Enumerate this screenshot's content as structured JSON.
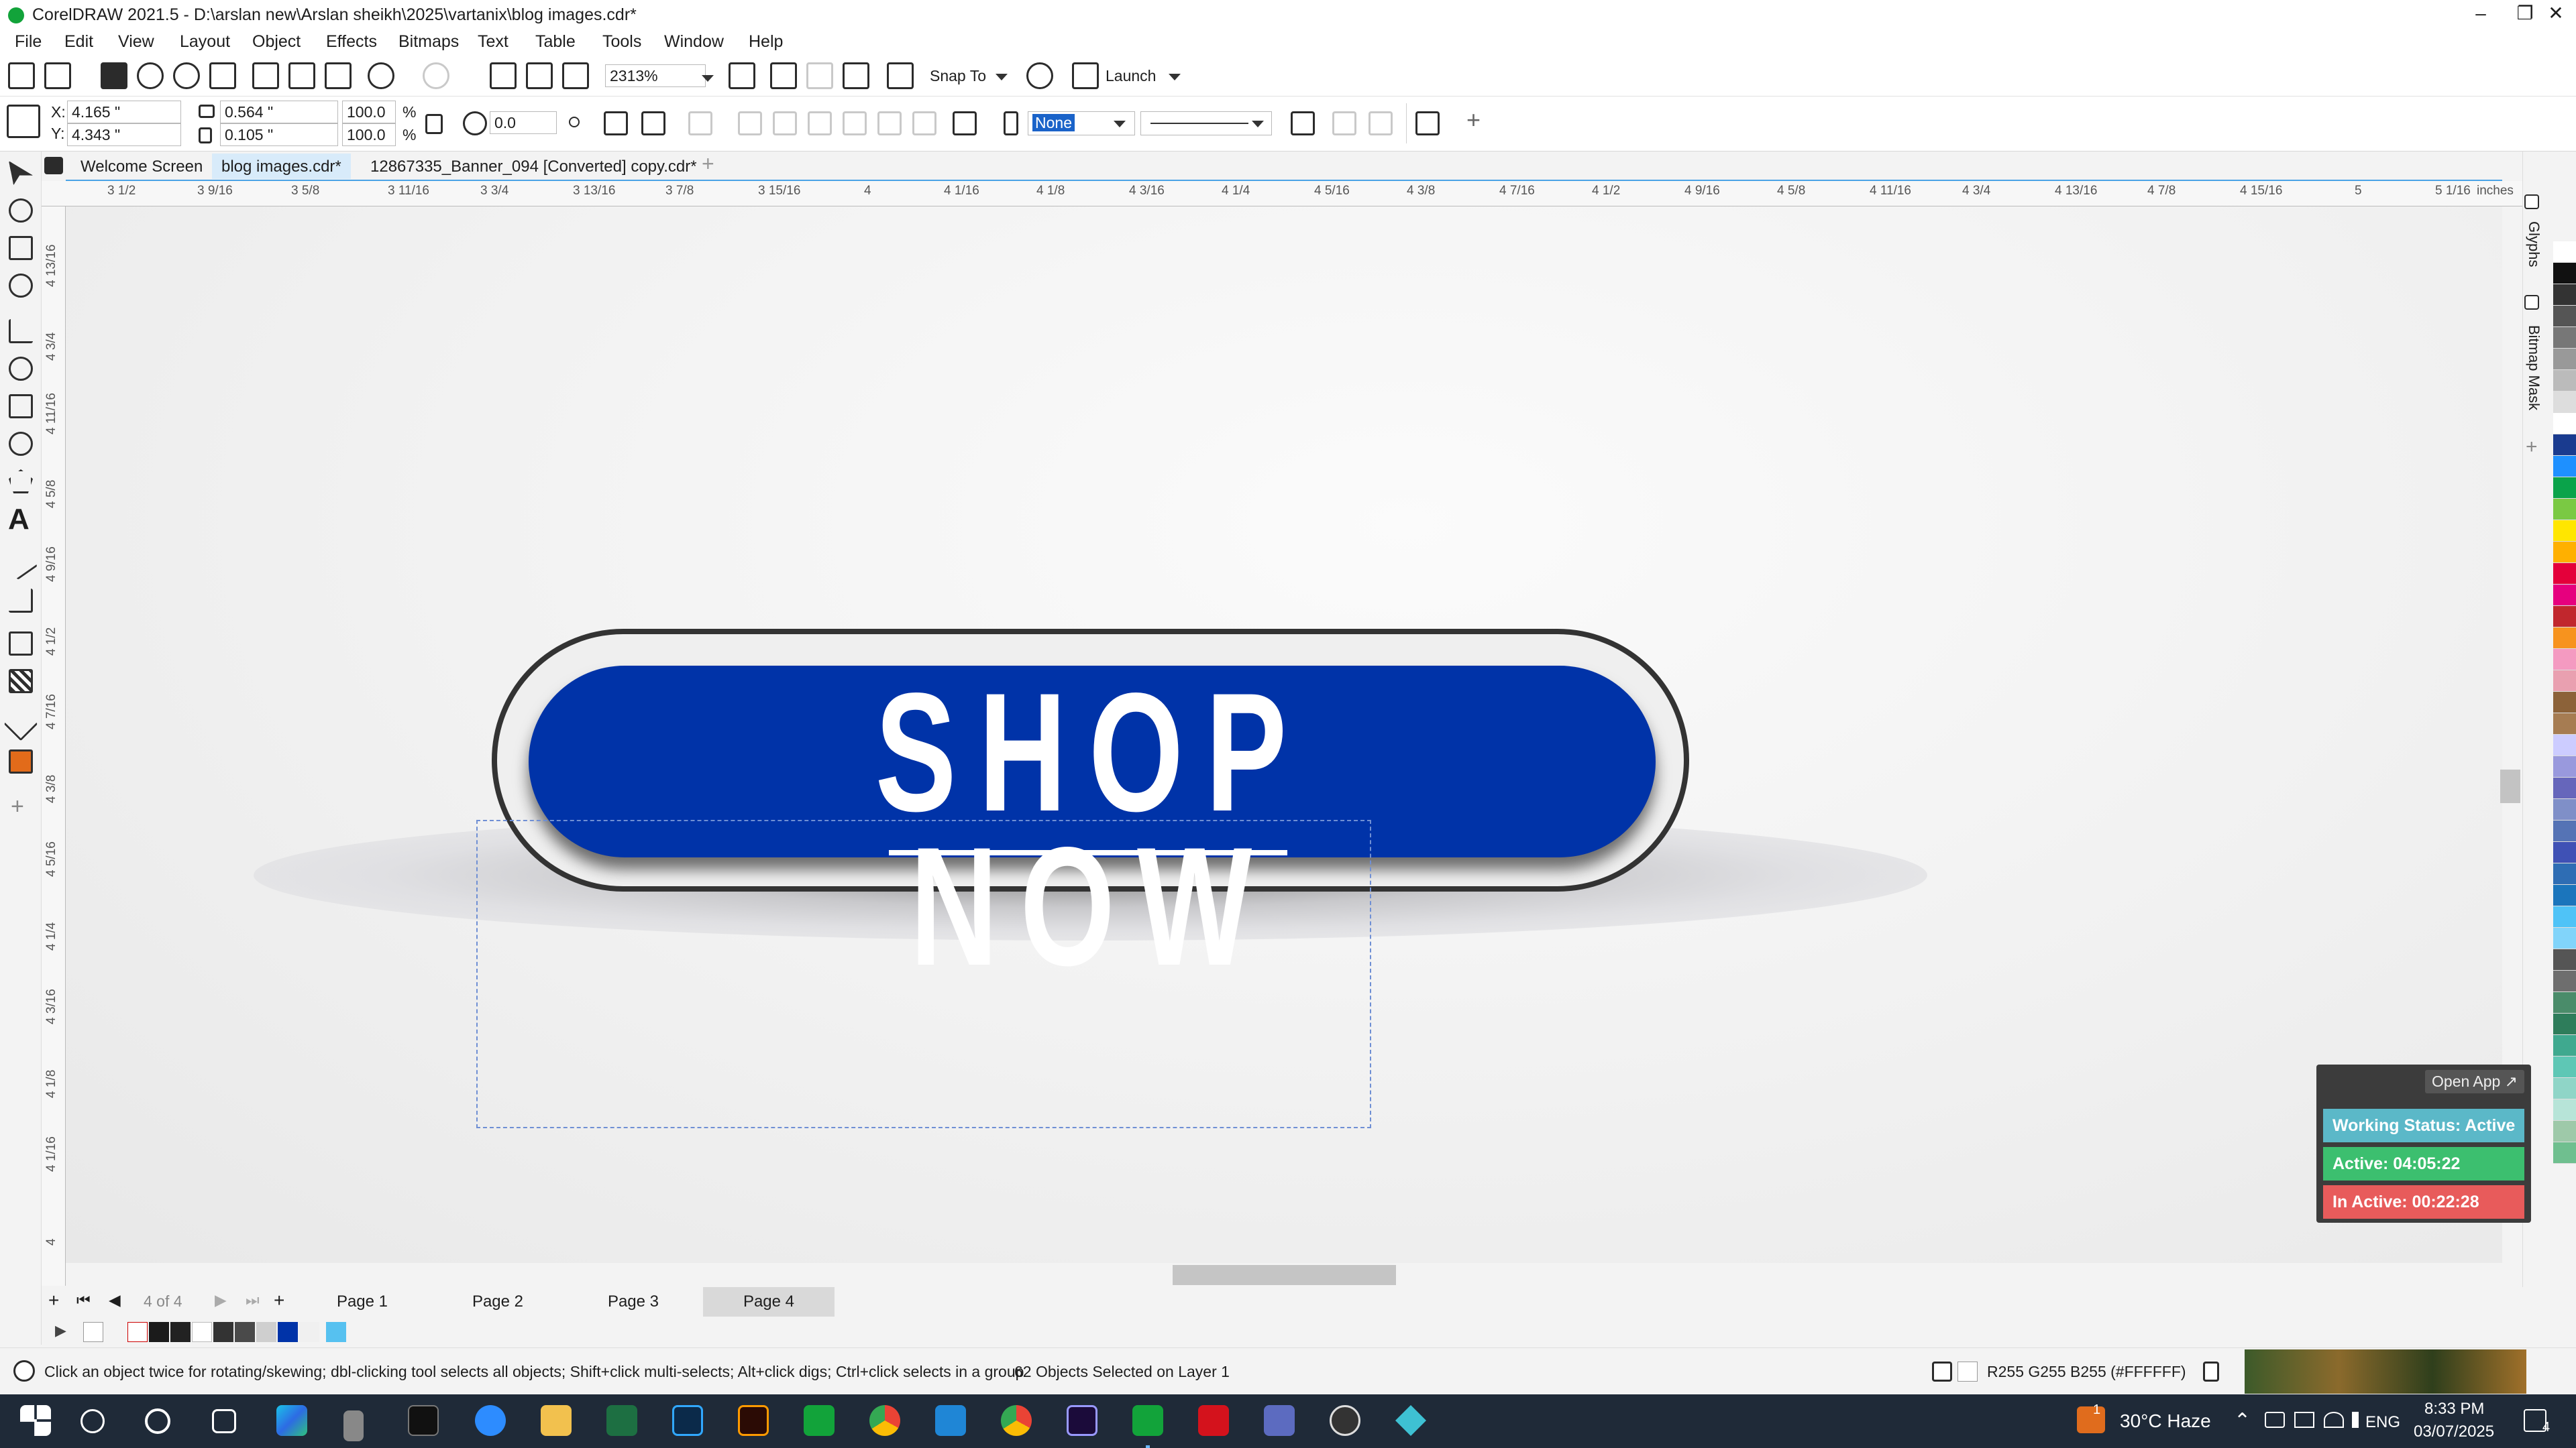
{
  "window": {
    "title": "CorelDRAW 2021.5 - D:\\arslan new\\Arslan sheikh\\2025\\vartanix\\blog images.cdr*"
  },
  "menu": [
    "File",
    "Edit",
    "View",
    "Layout",
    "Object",
    "Effects",
    "Bitmaps",
    "Text",
    "Table",
    "Tools",
    "Window",
    "Help"
  ],
  "toolbar": {
    "zoom": "2313%",
    "snap_label": "Snap To",
    "launch_label": "Launch"
  },
  "property_bar": {
    "x_label": "X:",
    "x_value": "4.165 \"",
    "y_label": "Y:",
    "y_value": "4.343 \"",
    "width_value": "0.564 \"",
    "height_value": "0.105 \"",
    "scale_w": "100.0",
    "scale_h": "100.0",
    "percent": "%",
    "rotation": "0.0",
    "outline_width": "None"
  },
  "doc_tabs": [
    "Welcome Screen",
    "blog images.cdr*",
    "12867335_Banner_094 [Converted] copy.cdr*"
  ],
  "ruler": {
    "h_labels": [
      "3 1/2",
      "3 9/16",
      "3 5/8",
      "3 11/16",
      "3 3/4",
      "3 13/16",
      "3 7/8",
      "3 15/16",
      "4",
      "4 1/16",
      "4 1/8",
      "4 3/16",
      "4 1/4",
      "4 5/16",
      "4 3/8",
      "4 7/16",
      "4 1/2",
      "4 9/16",
      "4 5/8",
      "4 11/16",
      "4 3/4",
      "4 13/16",
      "4 7/8",
      "4 15/16",
      "5",
      "5 1/16"
    ],
    "units": "inches",
    "v_labels": [
      "4 13/16",
      "4 3/4",
      "4 11/16",
      "4 5/8",
      "4 9/16",
      "4 1/2",
      "4 7/16",
      "4 3/8",
      "4 5/16",
      "4 1/4",
      "4 3/16",
      "4 1/8",
      "4 1/16",
      "4"
    ]
  },
  "artwork": {
    "cta_text": "SHOP NOW",
    "pill_color": "#0033a8"
  },
  "dockers": {
    "glyphs": "Glyphs",
    "bitmap_mask": "Bitmap Mask"
  },
  "pages": {
    "counter": "4 of 4",
    "tabs": [
      "Page 1",
      "Page 2",
      "Page 3",
      "Page 4"
    ],
    "active": "Page 4"
  },
  "status": {
    "hint": "Click an object twice for rotating/skewing; dbl-clicking tool selects all objects; Shift+click multi-selects; Alt+click digs; Ctrl+click selects in a group",
    "selection": "62 Objects Selected on Layer 1",
    "fill_color": "R255 G255 B255 (#FFFFFF)"
  },
  "widget": {
    "open_app": "Open App ↗",
    "working": "Working Status: Active",
    "active": "Active: 04:05:22",
    "inactive": "In Active: 00:22:28"
  },
  "taskbar": {
    "weather": "30°C  Haze",
    "lang": "ENG",
    "time": "8:33 PM",
    "date": "03/07/2025",
    "notif": "4",
    "weather_badge": "1"
  },
  "palette_colors": [
    "#ffffff",
    "#111111",
    "#333333",
    "#555555",
    "#777777",
    "#999999",
    "#bbbbbb",
    "#dddddd",
    "#ffffff",
    "#1a3b8f",
    "#1e90ff",
    "#0aa34a",
    "#7ac943",
    "#ffe600",
    "#ffb000",
    "#e4003a",
    "#e6007e",
    "#c1272d",
    "#f7931e",
    "#f49ac1",
    "#e9a0b0",
    "#8c6239",
    "#a67c52",
    "#ccccff",
    "#9999dd",
    "#6666bb",
    "#7f8fc8",
    "#5573b5",
    "#3f51b5",
    "#2e6db4",
    "#1b75bc",
    "#4fc3f7",
    "#81d4fa",
    "#555555",
    "#6e6e6e",
    "#4a8c6a",
    "#2e7d5b",
    "#3fa98f",
    "#5ec7b5",
    "#8fd5c7",
    "#b7e4d8",
    "#9ec9a9",
    "#6fbf8f"
  ]
}
